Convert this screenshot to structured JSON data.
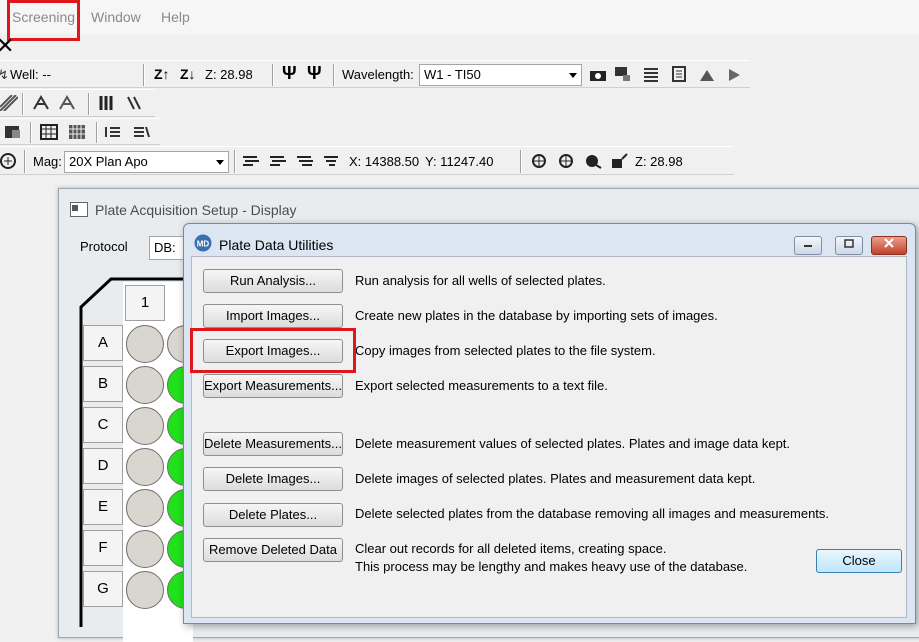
{
  "menu": {
    "items": [
      "Screening",
      "Window",
      "Help"
    ]
  },
  "toolbar1": {
    "close_glyph": "✕",
    "well_label": "Well: --",
    "z_label": "Z: 28.98",
    "wavelength_label": "Wavelength:",
    "wavelength_value": "W1 - TI50"
  },
  "toolbar4": {
    "mag_label": "Mag:",
    "mag_value": "20X Plan Apo",
    "x_label": "X: 14388.50",
    "y_label": "Y: 11247.40",
    "z_label": "Z: 28.98"
  },
  "plate_window": {
    "title": "Plate Acquisition Setup - Display",
    "protocol_label": "Protocol",
    "db_label": "DB:",
    "column_header": "1",
    "rows": [
      "A",
      "B",
      "C",
      "D",
      "E",
      "F",
      "G"
    ]
  },
  "dialog": {
    "title": "Plate Data Utilities",
    "actions": [
      {
        "label": "Run Analysis...",
        "description": "Run analysis for all wells of selected plates."
      },
      {
        "label": "Import Images...",
        "description": "Create new plates in the database by importing sets of images."
      },
      {
        "label": "Export Images...",
        "description": "Copy images from selected plates to the file system."
      },
      {
        "label": "Export Measurements...",
        "description": "Export selected measurements to a text file."
      },
      {
        "label": "Delete Measurements...",
        "description": "Delete measurement values of selected plates. Plates and image data kept."
      },
      {
        "label": "Delete Images...",
        "description": "Delete images of selected plates. Plates and measurement data kept."
      },
      {
        "label": "Delete Plates...",
        "description": "Delete selected plates from the database removing all images and measurements."
      },
      {
        "label": "Remove Deleted Data",
        "description": "Clear out records for all deleted items, creating space.",
        "description2": "This process may be lengthy and makes heavy use of the database."
      }
    ],
    "close_label": "Close"
  },
  "colors": {
    "highlight": "#e0161d",
    "well_green": "#22e01b",
    "well_gray": "#d9d6d0"
  }
}
